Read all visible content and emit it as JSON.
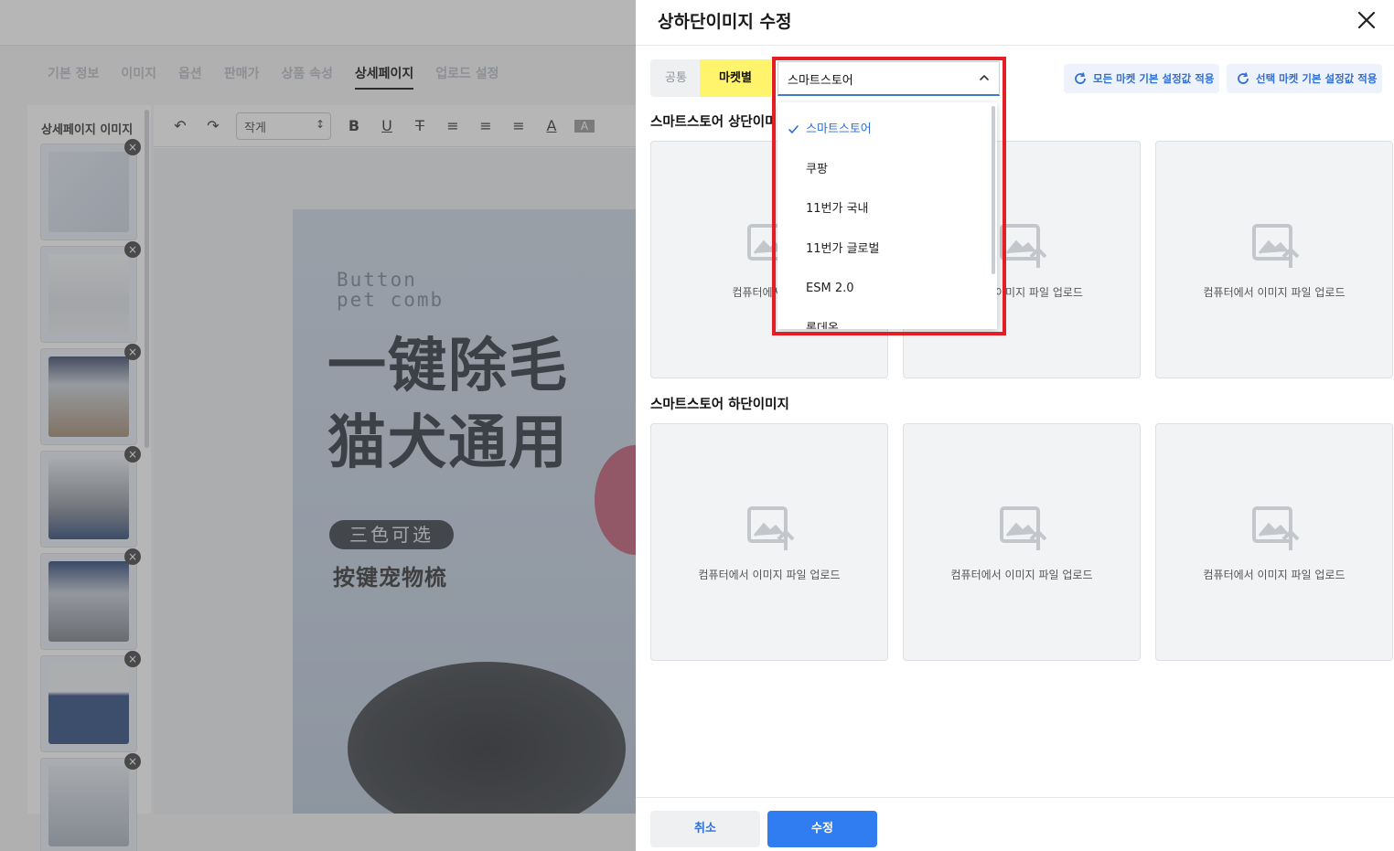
{
  "background": {
    "tabs": [
      {
        "label": "기본 정보",
        "active": false
      },
      {
        "label": "이미지",
        "active": false
      },
      {
        "label": "옵션",
        "active": false
      },
      {
        "label": "판매가",
        "active": false
      },
      {
        "label": "상품 속성",
        "active": false
      },
      {
        "label": "상세페이지",
        "active": true
      },
      {
        "label": "업로드 설정",
        "active": false
      }
    ],
    "sidebar_title": "상세페이지 이미지",
    "font_size_select": "작게",
    "product_image": {
      "english_text": "Button\npet comb",
      "headline_1": "一键除毛",
      "headline_2": "猫犬通用",
      "pill": "三色可选",
      "subtitle": "按键宠物梳"
    }
  },
  "panel": {
    "title": "상하단이미지 수정",
    "segments": {
      "common": "공통",
      "market": "마켓별"
    },
    "market_select": {
      "value": "스마트스토어"
    },
    "apply_all_button": "모든 마켓 기본 설정값 적용",
    "apply_selected_button": "선택 마켓 기본 설정값 적용",
    "top_section_title": "스마트스토어 상단이미",
    "bottom_section_title": "스마트스토어 하단이미지",
    "upload_boxes": {
      "top": [
        {
          "label": "컴퓨터에서 이미"
        },
        {
          "label": "이미지 파일 업로드"
        },
        {
          "label": "컴퓨터에서 이미지 파일 업로드"
        }
      ],
      "bottom": [
        {
          "label": "컴퓨터에서 이미지 파일 업로드"
        },
        {
          "label": "컴퓨터에서 이미지 파일 업로드"
        },
        {
          "label": "컴퓨터에서 이미지 파일 업로드"
        }
      ]
    },
    "footer": {
      "cancel": "취소",
      "submit": "수정"
    }
  },
  "dropdown": {
    "options": [
      {
        "label": "스마트스토어",
        "selected": true
      },
      {
        "label": "쿠팡",
        "selected": false
      },
      {
        "label": "11번가 국내",
        "selected": false
      },
      {
        "label": "11번가 글로벌",
        "selected": false
      },
      {
        "label": "ESM 2.0",
        "selected": false
      },
      {
        "label": "롯데온",
        "selected": false
      }
    ]
  },
  "colors": {
    "accent": "#2f7df0",
    "market_tab_highlight": "#fff46b",
    "annotation_border": "#e31e24"
  }
}
